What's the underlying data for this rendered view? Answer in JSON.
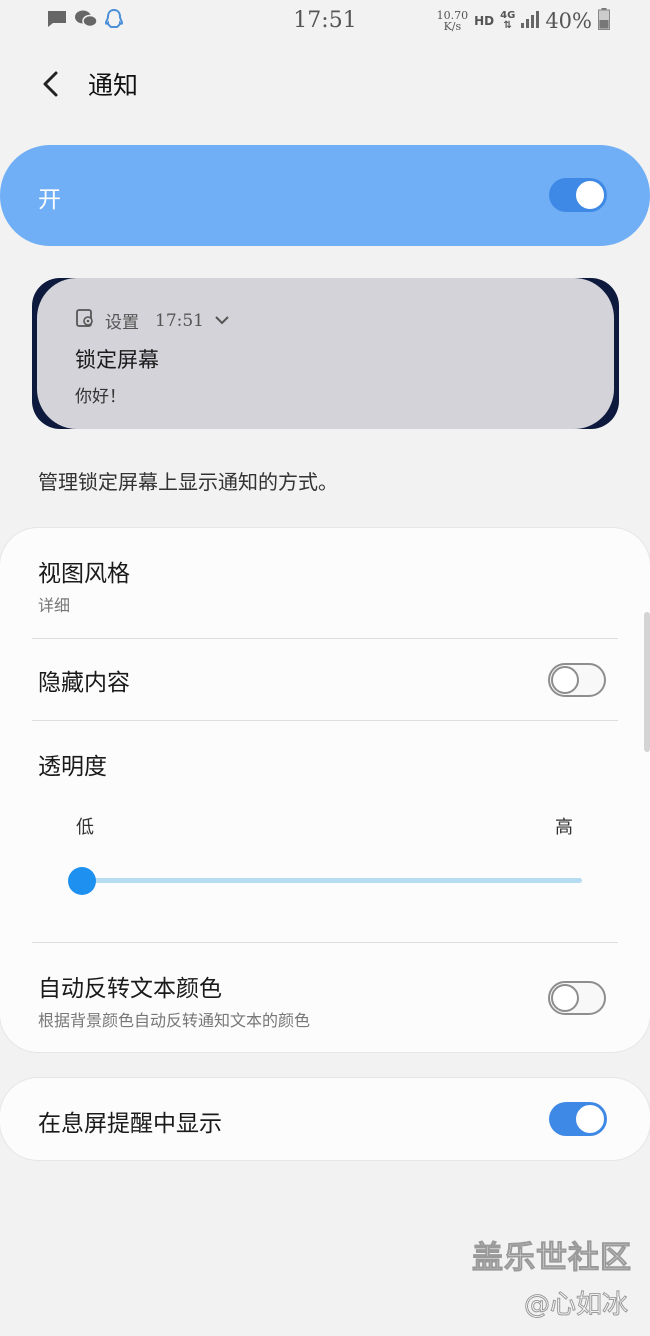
{
  "status_bar": {
    "time": "17:51",
    "net_speed_value": "10.70",
    "net_speed_unit": "K/s",
    "hd": "HD",
    "network": "4G",
    "battery": "40%",
    "icons": [
      "message-icon",
      "wechat-icon",
      "qq-icon",
      "signal-icon",
      "battery-icon"
    ]
  },
  "header": {
    "title": "通知"
  },
  "master_switch": {
    "label": "开",
    "on": true
  },
  "preview": {
    "app": "设置",
    "time": "17:51",
    "title": "锁定屏幕",
    "body": "你好！"
  },
  "description": "管理锁定屏幕上显示通知的方式。",
  "settings": {
    "view_style": {
      "title": "视图风格",
      "value": "详细"
    },
    "hide_content": {
      "title": "隐藏内容",
      "on": false
    },
    "transparency": {
      "title": "透明度",
      "low": "低",
      "high": "高",
      "level": 0
    },
    "auto_invert": {
      "title": "自动反转文本颜色",
      "subtitle": "根据背景颜色自动反转通知文本的颜色",
      "on": false
    }
  },
  "aod": {
    "title": "在息屏提醒中显示",
    "on": true
  },
  "watermark": {
    "main": "盖乐世社区",
    "sub": "@心如冰"
  },
  "colors": {
    "accent": "#3f89e6",
    "master_bg": "#70aef5",
    "slider_track": "#b6dcf2",
    "slider_thumb": "#1e90f0"
  }
}
